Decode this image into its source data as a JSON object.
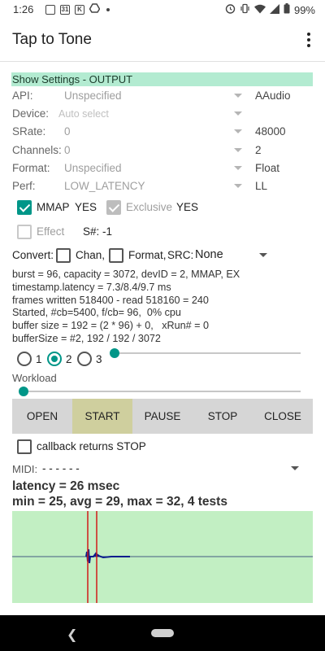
{
  "status_bar": {
    "time": "1:26",
    "battery": "99%",
    "left_icons": [
      "message-icon",
      "calendar-icon",
      "k-app-icon",
      "drive-icon",
      "dot-icon"
    ],
    "right_icons": [
      "alarm-icon",
      "vibrate-icon",
      "wifi-icon",
      "signal-icon",
      "battery-icon"
    ],
    "cal_day": "31",
    "k_letter": "K"
  },
  "app_bar": {
    "title": "Tap to Tone"
  },
  "settings": {
    "header": "Show Settings - OUTPUT",
    "rows": [
      {
        "label": "API:",
        "value": "Unspecified",
        "actual": "AAudio"
      },
      {
        "label": "Device:",
        "value": "Auto select",
        "actual": ""
      },
      {
        "label": "SRate:",
        "value": "0",
        "actual": "48000"
      },
      {
        "label": "Channels:",
        "value": "0",
        "actual": "2"
      },
      {
        "label": "Format:",
        "value": "Unspecified",
        "actual": "Float"
      },
      {
        "label": "Perf:",
        "value": "LOW_LATENCY",
        "actual": "LL"
      }
    ],
    "mmap_label": "MMAP",
    "mmap_value": "YES",
    "exclusive_label": "Exclusive",
    "exclusive_value": "YES",
    "effect_label": "Effect",
    "session": "S#: -1",
    "convert_label": "Convert:",
    "chan_label": "Chan,",
    "format_label": "Format,",
    "src_label": "SRC:",
    "src_value": "None"
  },
  "info_text": "burst = 96, capacity = 3072, devID = 2, MMAP, EX\ntimestamp.latency = 7.3/8.4/9.7 ms\nframes written 518400 - read 518160 = 240\nStarted, #cb=5400, f/cb= 96,  0% cpu\nbuffer size = 192 = (2 * 96) + 0,   xRun# = 0\nbufferSize = #2, 192 / 192 / 3072",
  "burst_options": [
    "1",
    "2",
    "3"
  ],
  "selected_burst": "2",
  "buffer_slider_fraction": 0.0,
  "workload_label": "Workload",
  "workload_slider_fraction": 0.0,
  "buttons": [
    "OPEN",
    "START",
    "PAUSE",
    "STOP",
    "CLOSE"
  ],
  "active_button": "START",
  "callback_stop_label": "callback returns STOP",
  "midi_label": "MIDI:",
  "midi_value": "- - - - - -",
  "latency_line": "latency =  26 msec",
  "stats_line": "min =  25, avg =  29, max =  32, 4 tests",
  "colors": {
    "accent": "#009688",
    "settings_header_bg": "#b3ebd1",
    "active_button_bg": "#cfcf9e",
    "button_bar_bg": "#d6d6d6",
    "scope_bg": "#c2efc3",
    "scope_marker": "#d11a1a",
    "scope_wave": "#0b1d8c"
  }
}
